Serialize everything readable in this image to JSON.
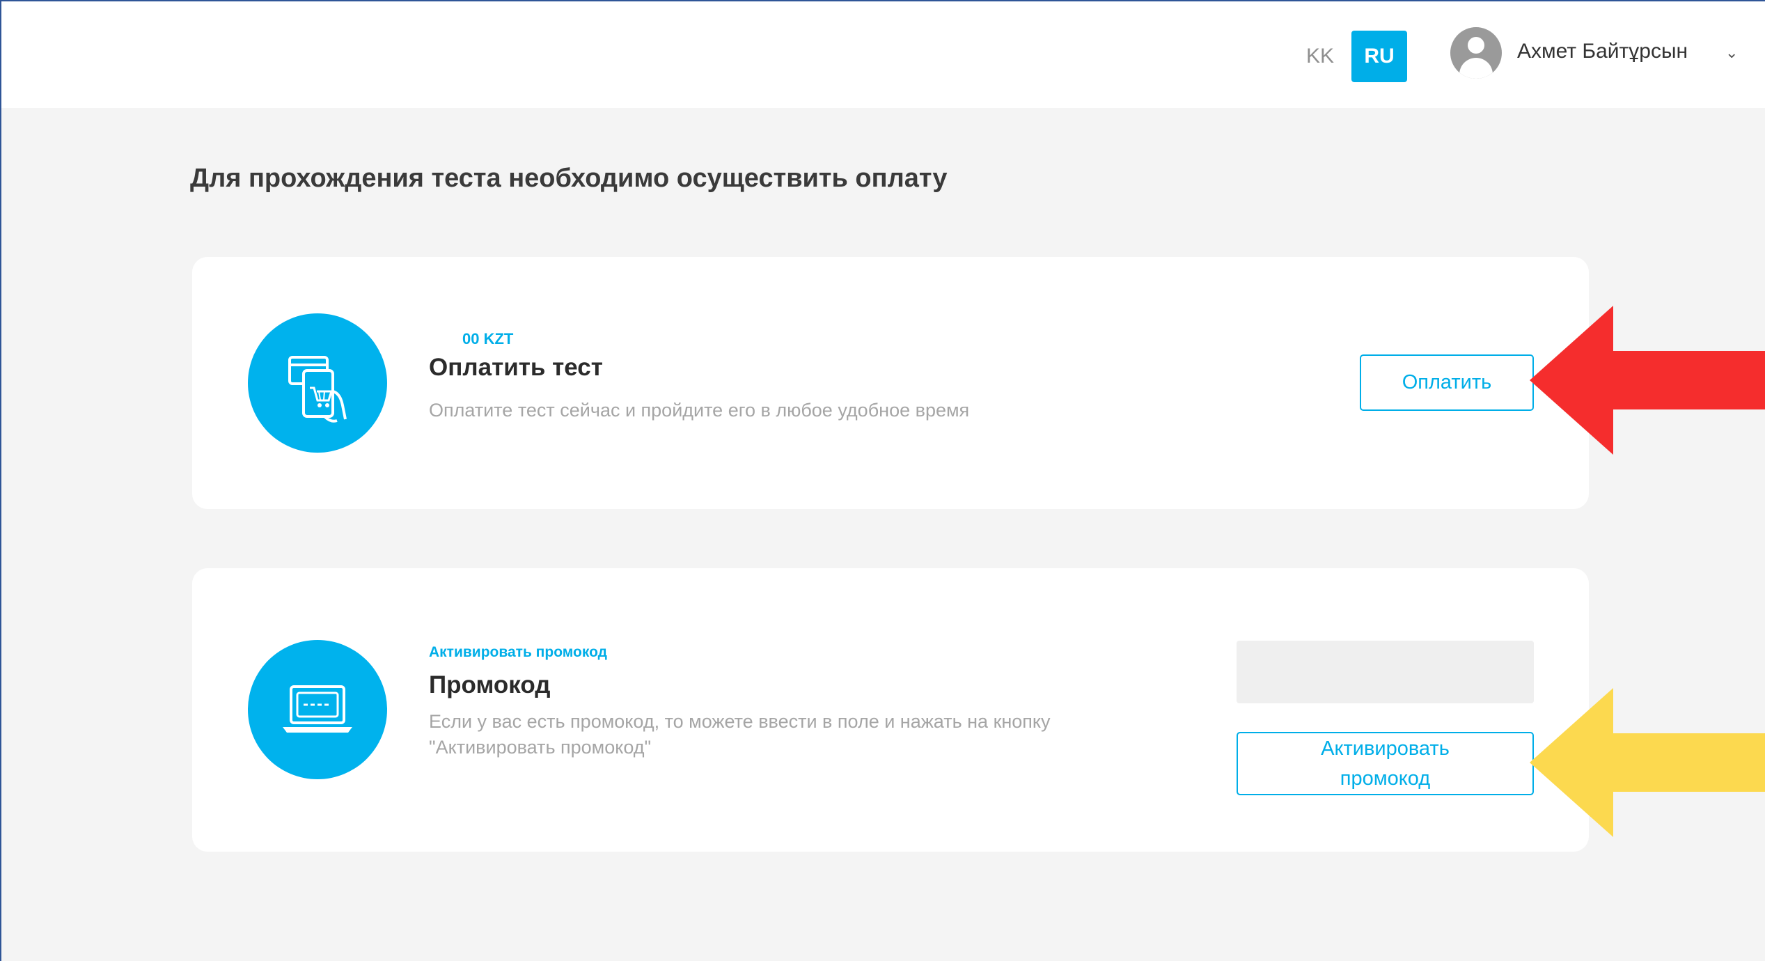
{
  "header": {
    "languages": [
      {
        "code": "KK",
        "active": false
      },
      {
        "code": "RU",
        "active": true
      }
    ],
    "user_name": "Ахмет Байтұрсын",
    "avatar_icon": "user-avatar-icon",
    "dropdown_icon": "chevron-down-icon",
    "accent_color": "#00aee8"
  },
  "page": {
    "title": "Для прохождения теста необходимо осуществить оплату"
  },
  "payment_card": {
    "icon": "card-shopping-icon",
    "price": "00 KZT",
    "title": "Оплатить тест",
    "description": "Оплатите тест сейчас и пройдите его в любое удобное время",
    "button_label": "Оплатить"
  },
  "promo_card": {
    "icon": "laptop-icon",
    "tag": "Активировать промокод",
    "title": "Промокод",
    "description": "Если у вас есть промокод, то можете ввести в поле и нажать на кнопку \"Активировать промокод\"",
    "input_value": "",
    "button_label": "Активировать промокод"
  },
  "annotations": {
    "red_arrow_color": "#f52d2d",
    "yellow_arrow_color": "#fcd94f"
  }
}
